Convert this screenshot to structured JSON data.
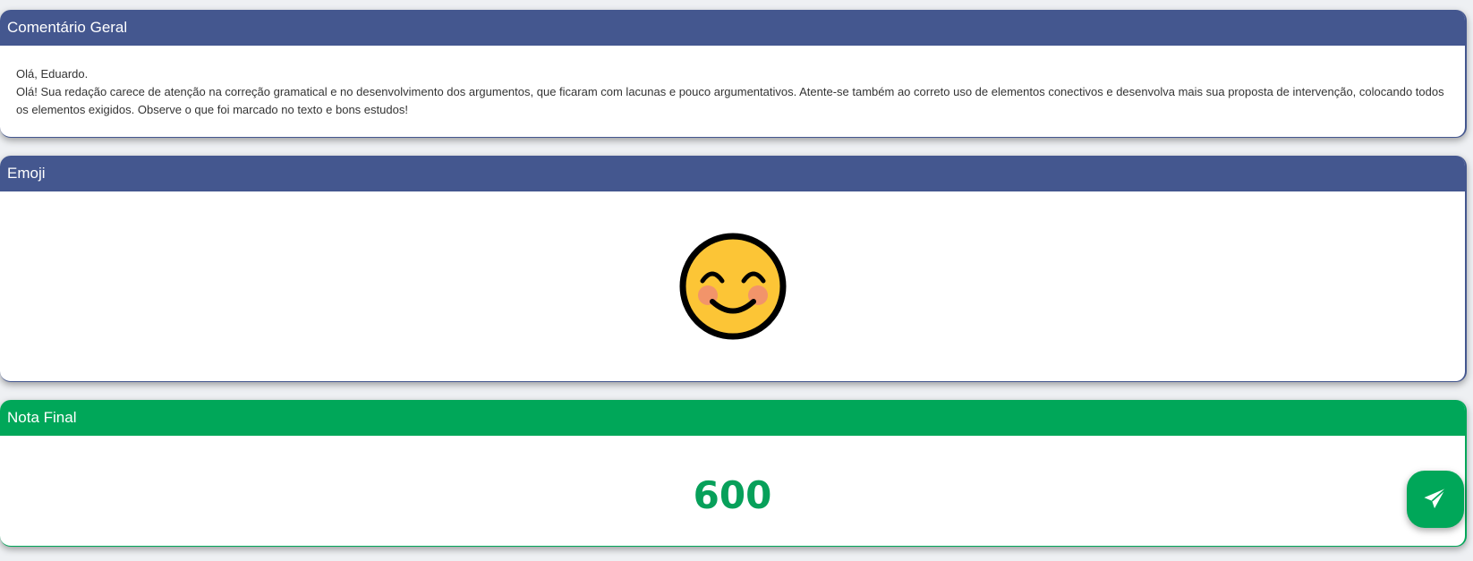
{
  "colors": {
    "header_blue": "#44578f",
    "header_green": "#00a759",
    "grade_text": "#07a05a",
    "fab_background": "#00a759"
  },
  "comment": {
    "title": "Comentário Geral",
    "greeting": "Olá, Eduardo.",
    "body": "Olá! Sua redação carece de atenção na correção gramatical e no desenvolvimento dos argumentos, que ficaram com lacunas e pouco argumentativos. Atente-se também ao correto uso de elementos conectivos e desenvolva mais sua proposta de intervenção, colocando todos os elementos exigidos. Observe o que foi marcado no texto e bons estudos!"
  },
  "emoji": {
    "title": "Emoji",
    "icon": "smiling-face-icon"
  },
  "grade": {
    "title": "Nota Final",
    "value": "600"
  },
  "fab": {
    "icon": "paper-plane-icon"
  }
}
